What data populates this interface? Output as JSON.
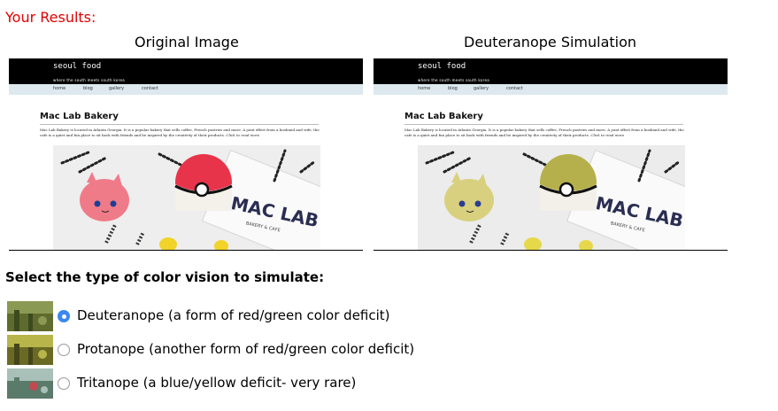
{
  "results_heading": "Your Results:",
  "panels": [
    {
      "title": "Original Image",
      "site": {
        "brand": "seoul food",
        "tagline": "where the south meets south korea",
        "nav": [
          "home",
          "blog",
          "gallery",
          "contact"
        ],
        "heading": "Mac Lab Bakery",
        "body": "Mac Lab Bakery is located in Atlanta Georgia. It is a popular bakery that sells coffee, French pastries and more. A joint effort from a husband and wife, the cafe is a quiet and fun place to sit back with friends and be inspired by the creativity of their products.",
        "read_more": "Click to read more",
        "logo_text": "MAC LAB",
        "logo_sub": "BAKERY & CAFE"
      },
      "colors": {
        "left_macaron": "#f07b88",
        "right_macaron": "#e8344a",
        "eyes": "#1c3f95"
      }
    },
    {
      "title": "Deuteranope Simulation",
      "site": {
        "brand": "seoul food",
        "tagline": "where the south meets south korea",
        "nav": [
          "home",
          "blog",
          "gallery",
          "contact"
        ],
        "heading": "Mac Lab Bakery",
        "body": "Mac Lab Bakery is located in Atlanta Georgia. It is a popular bakery that sells coffee, French pastries and more. A joint effort from a husband and wife, the cafe is a quiet and fun place to sit back with friends and be inspired by the creativity of their products.",
        "read_more": "Click to read more",
        "logo_text": "MAC LAB",
        "logo_sub": "BAKERY & CAFE"
      },
      "colors": {
        "left_macaron": "#d9d07f",
        "right_macaron": "#b6b04c",
        "eyes": "#2a3d8f"
      }
    }
  ],
  "question": "Select the type of color vision to simulate:",
  "options": [
    {
      "label": "Deuteranope (a form of red/green color deficit)",
      "checked": true,
      "thumb_colors": [
        "#5f6a2e",
        "#8a9a55",
        "#3d4a1f"
      ]
    },
    {
      "label": "Protanope (another form of red/green color deficit)",
      "checked": false,
      "thumb_colors": [
        "#6a6a25",
        "#b8b54a",
        "#44451b"
      ]
    },
    {
      "label": "Tritanope (a blue/yellow deficit- very rare)",
      "checked": false,
      "thumb_colors": [
        "#5a7a6a",
        "#a8c0b8",
        "#c04a50"
      ]
    }
  ]
}
